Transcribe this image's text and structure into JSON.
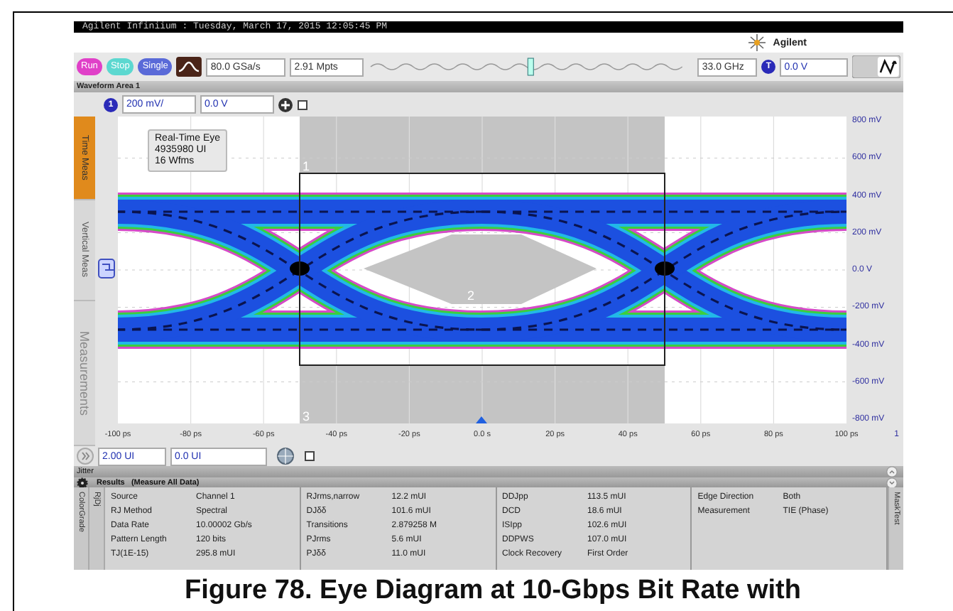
{
  "window": {
    "title": "Agilent Infiniium : Tuesday, March 17, 2015 12:05:45 PM"
  },
  "brand": {
    "name": "Agilent"
  },
  "toolbar": {
    "buttons": [
      {
        "label": "Run",
        "kind": "run"
      },
      {
        "label": "Stop",
        "kind": "stop"
      },
      {
        "label": "Single",
        "kind": "single"
      }
    ],
    "sample_rate": "80.0 GSa/s",
    "memory_depth": "2.91 Mpts",
    "bandwidth": "33.0 GHz",
    "time_position": {
      "level": 0.5
    },
    "trigger_source": "T",
    "trigger_level": "0.0 V"
  },
  "waveform_area": {
    "title": "Waveform Area 1",
    "channel": "1",
    "scale": "200 mV/",
    "offset": "0.0 V",
    "side_tabs": [
      {
        "label": "Time Meas",
        "selected": true
      },
      {
        "label": "Vertical Meas",
        "selected": false
      },
      {
        "label": "Measurements",
        "selected": false
      }
    ],
    "info": [
      "Real-Time Eye",
      "4935980 UI",
      "16 Wfms"
    ],
    "mask_regions": [
      "1",
      "2",
      "3"
    ],
    "y_labels": [
      "800 mV",
      "600 mV",
      "400 mV",
      "200 mV",
      "0.0 V",
      "-200 mV",
      "-400 mV",
      "-600 mV",
      "-800 mV"
    ],
    "x_labels": [
      "-100 ps",
      "-80 ps",
      "-60 ps",
      "-40 ps",
      "-20 ps",
      "0.0 s",
      "20 ps",
      "40 ps",
      "60 ps",
      "80 ps",
      "100 ps"
    ],
    "x_axis_marker": "1"
  },
  "timebase": {
    "scale": "2.00 UI",
    "position": "0.0 UI"
  },
  "jitter_panel": {
    "title": "Jitter"
  },
  "results": {
    "title": "Results   (Measure All Data)",
    "left_tabs": [
      "ColorGrade",
      "RjDj"
    ],
    "right_tab": "MaskTest",
    "columns": [
      [
        {
          "label": "Source",
          "value": "Channel 1"
        },
        {
          "label": "RJ Method",
          "value": "Spectral"
        },
        {
          "label": "Data Rate",
          "value": "10.00002 Gb/s"
        },
        {
          "label": "Pattern Length",
          "value": "120 bits"
        },
        {
          "label": "TJ(1E-15)",
          "value": "295.8 mUI"
        }
      ],
      [
        {
          "label": "RJrms,narrow",
          "value": "12.2 mUI"
        },
        {
          "label": "DJδδ",
          "value": "101.6 mUI"
        },
        {
          "label": "Transitions",
          "value": "2.879258 M"
        },
        {
          "label": "PJrms",
          "value": "5.6 mUI"
        },
        {
          "label": "PJδδ",
          "value": "11.0 mUI"
        }
      ],
      [
        {
          "label": "DDJpp",
          "value": "113.5 mUI"
        },
        {
          "label": "DCD",
          "value": "18.6 mUI"
        },
        {
          "label": "ISIpp",
          "value": "102.6 mUI"
        },
        {
          "label": "DDPWS",
          "value": "107.0 mUI"
        },
        {
          "label": "Clock Recovery",
          "value": "First Order"
        }
      ],
      [
        {
          "label": "Edge Direction",
          "value": "Both"
        },
        {
          "label": "Measurement",
          "value": "TIE (Phase)"
        }
      ]
    ]
  },
  "caption": "Figure 78. Eye Diagram at 10-Gbps Bit Rate with"
}
